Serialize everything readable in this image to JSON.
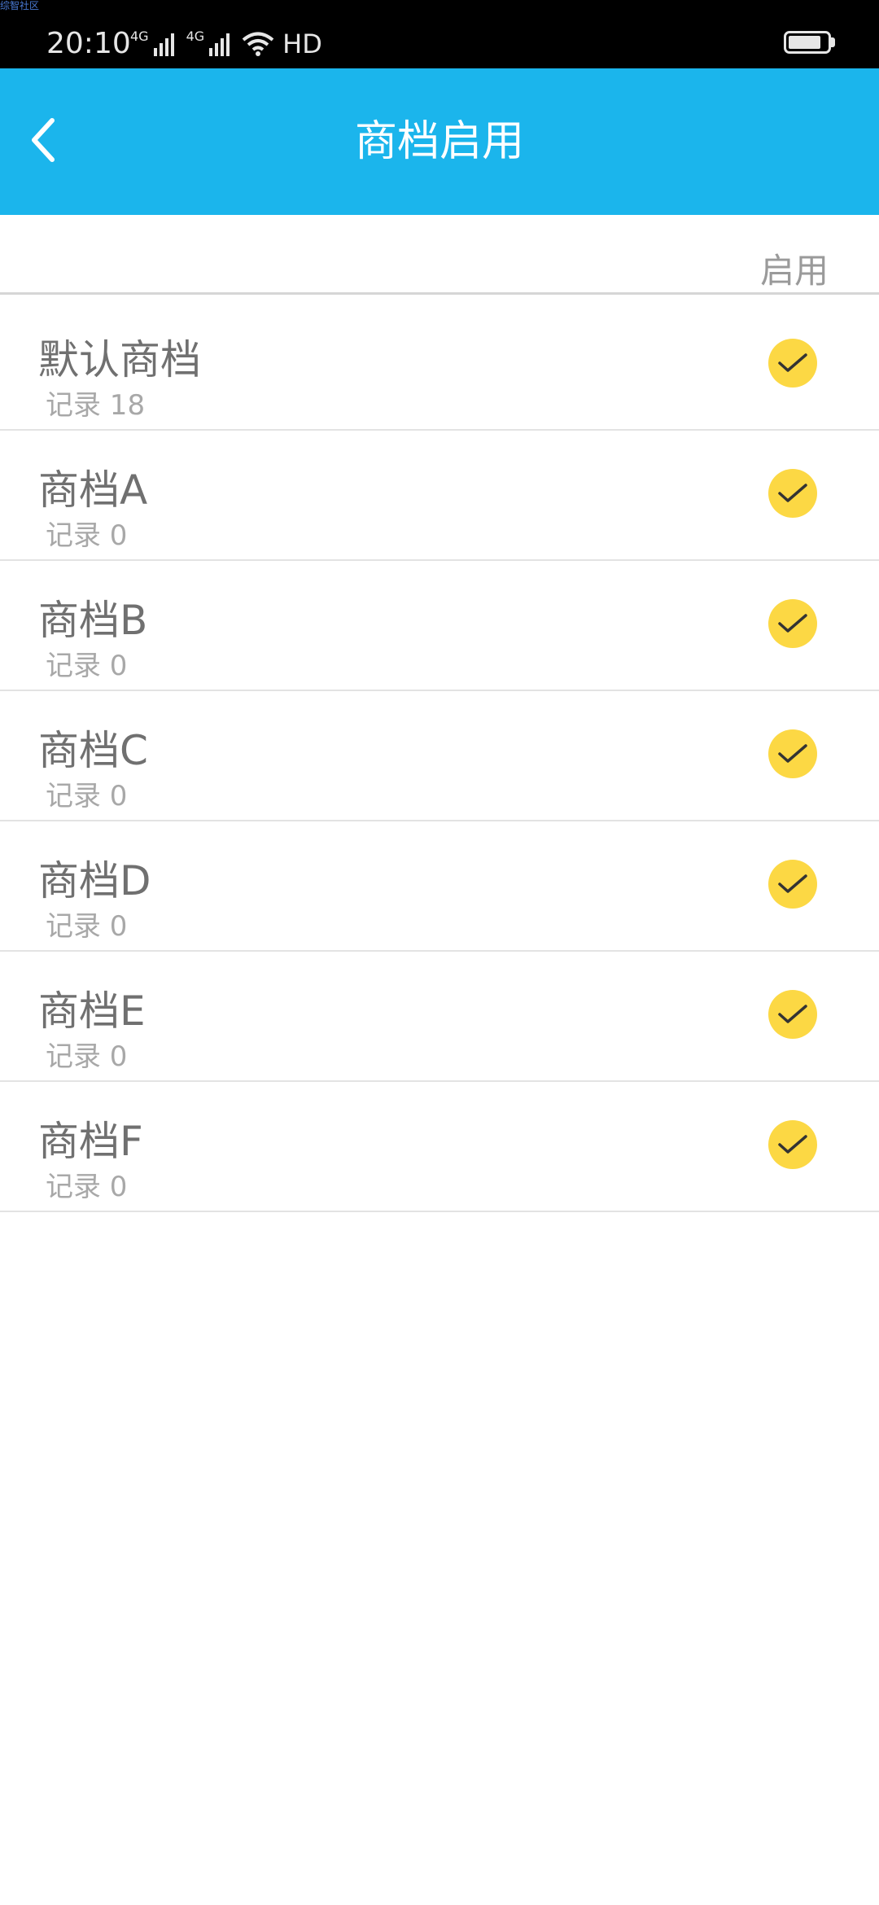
{
  "status_bar": {
    "watermark": "综智社区",
    "time": "20:10",
    "network_1": "4G",
    "network_2": "4G",
    "hd_label": "HD",
    "battery_level": 0.85
  },
  "app_bar": {
    "title": "商档启用",
    "back_icon": "chevron-left-icon",
    "background_color": "#1bb5ec"
  },
  "list_header": {
    "enable_label": "启用"
  },
  "check_color": "#fcd844",
  "check_icon": "checkmark-icon",
  "items": [
    {
      "name": "默认商档",
      "records": "记录 18",
      "enabled": true
    },
    {
      "name": "商档A",
      "records": "记录 0",
      "enabled": true
    },
    {
      "name": "商档B",
      "records": "记录 0",
      "enabled": true
    },
    {
      "name": "商档C",
      "records": "记录 0",
      "enabled": true
    },
    {
      "name": "商档D",
      "records": "记录 0",
      "enabled": true
    },
    {
      "name": "商档E",
      "records": "记录 0",
      "enabled": true
    },
    {
      "name": "商档F",
      "records": "记录 0",
      "enabled": true
    }
  ]
}
